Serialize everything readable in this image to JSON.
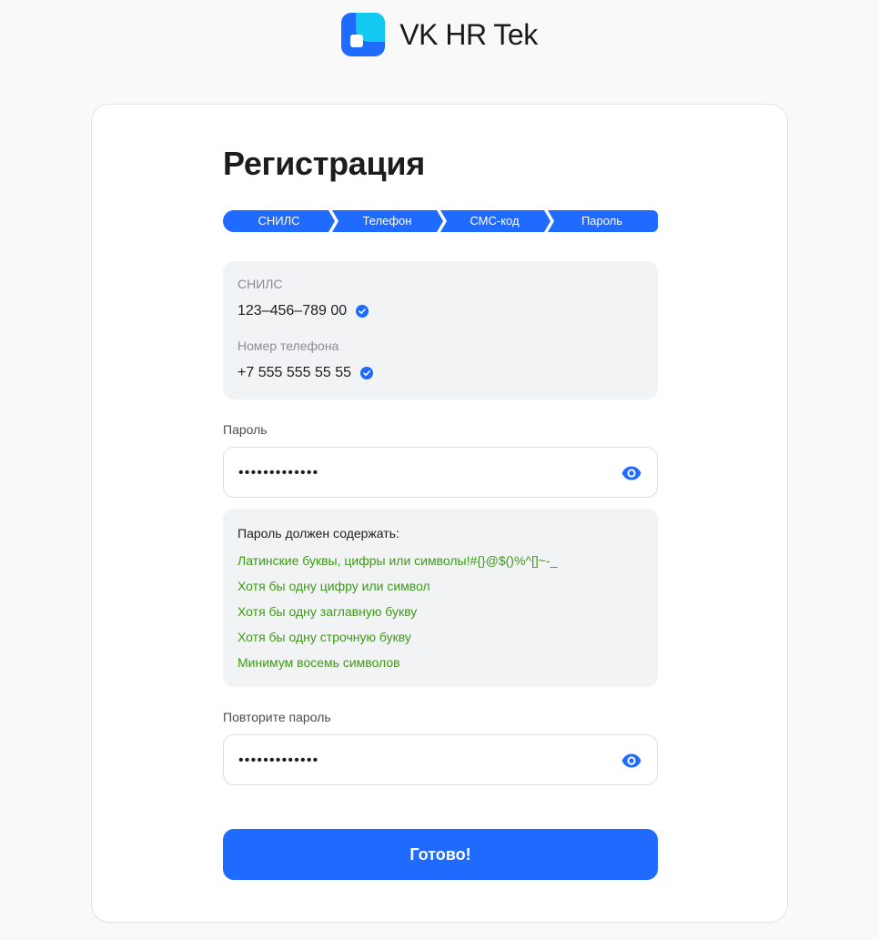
{
  "brand": {
    "name": "VK HR Tek",
    "icon": "vk-hr-tek-logo"
  },
  "form": {
    "title": "Регистрация",
    "steps": [
      "СНИЛС",
      "Телефон",
      "СМС-код",
      "Пароль"
    ],
    "step_color": "#1f6bff",
    "info": {
      "snils_label": "СНИЛС",
      "snils_value": "123–456–789 00",
      "phone_label": "Номер телефона",
      "phone_value": "+7 555 555 55 55",
      "verified_icon": "check-circle-icon"
    },
    "password": {
      "label": "Пароль",
      "value": "•••••••••••••",
      "toggle_icon": "eye-icon"
    },
    "requirements": {
      "title": "Пароль должен содержать:",
      "color": "#3d9a17",
      "items": [
        "Латинские буквы, цифры или символы!#{}@$()%^[]~-_",
        "Хотя бы одну цифру или символ",
        "Хотя бы одну заглавную букву",
        "Хотя бы одну строчную букву",
        "Минимум восемь символов"
      ]
    },
    "confirm": {
      "label": "Повторите пароль",
      "value": "•••••••••••••",
      "toggle_icon": "eye-icon"
    },
    "submit_label": "Готово!",
    "accent": "#1f6bff"
  }
}
